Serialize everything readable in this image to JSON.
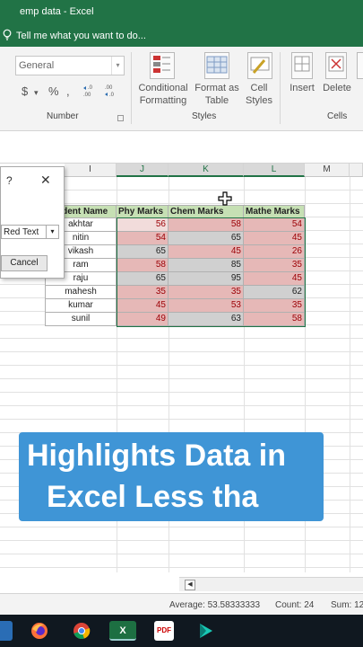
{
  "window": {
    "title": "emp data - Excel"
  },
  "tell_me": {
    "text": "Tell me what you want to do..."
  },
  "ribbon": {
    "number_format": "General",
    "currency_symbol": "$",
    "percent_symbol": "%",
    "comma_symbol": ",",
    "increase_decimal": ".0\n.00",
    "decrease_decimal": ".00\n→.0",
    "number_group_label": "Number",
    "conditional_formatting": [
      "Conditional",
      "Formatting"
    ],
    "format_as_table": [
      "Format as",
      "Table"
    ],
    "cell_styles": [
      "Cell",
      "Styles"
    ],
    "styles_group_label": "Styles",
    "insert": "Insert",
    "delete": "Delete",
    "cells_group_label": "Cells"
  },
  "columns": [
    "I",
    "J",
    "K",
    "L",
    "M"
  ],
  "table": {
    "headers": [
      "Student Name",
      "Phy Marks",
      "Chem Marks",
      "Mathe Marks"
    ],
    "rows": [
      {
        "name": "akhtar",
        "phy": "56",
        "chem": "58",
        "math": "54"
      },
      {
        "name": "nitin",
        "phy": "54",
        "chem": "65",
        "math": "45"
      },
      {
        "name": "vikash",
        "phy": "65",
        "chem": "45",
        "math": "26"
      },
      {
        "name": "ram",
        "phy": "58",
        "chem": "85",
        "math": "35"
      },
      {
        "name": "raju",
        "phy": "65",
        "chem": "95",
        "math": "45"
      },
      {
        "name": "mahesh",
        "phy": "35",
        "chem": "35",
        "math": "62"
      },
      {
        "name": "kumar",
        "phy": "45",
        "chem": "53",
        "math": "35"
      },
      {
        "name": "sunil",
        "phy": "49",
        "chem": "63",
        "math": "58"
      }
    ]
  },
  "dialog": {
    "help_symbol": "?",
    "close_symbol": "✕",
    "format_value": "Red Text",
    "cancel_label": "Cancel"
  },
  "banner": {
    "line1": "Highlights Data in",
    "line2": "Excel Less tha"
  },
  "status": {
    "average": "Average: 53.58333333",
    "count": "Count: 24",
    "sum": "Sum: 12"
  },
  "taskbar": {
    "excel_label": "X",
    "pdf_label": "PDF"
  },
  "colors": {
    "excel_green": "#217346",
    "header_fill": "#c6e0b4",
    "highlight_red": "#e6b8b7",
    "highlight_text": "#9c0006",
    "banner_blue": "#3f95d6"
  }
}
